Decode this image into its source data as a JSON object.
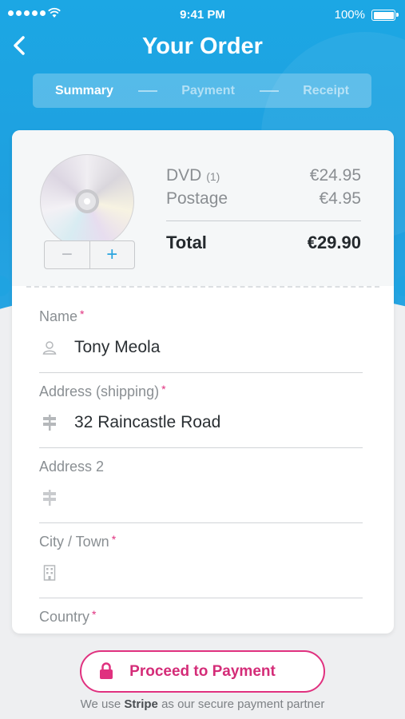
{
  "status_bar": {
    "time": "9:41 PM",
    "battery": "100%"
  },
  "header": {
    "title": "Your Order"
  },
  "steps": [
    {
      "label": "Summary",
      "active": true
    },
    {
      "label": "Payment",
      "active": false
    },
    {
      "label": "Receipt",
      "active": false
    }
  ],
  "order": {
    "item_name": "DVD",
    "item_qty": "(1)",
    "item_price": "€24.95",
    "postage_label": "Postage",
    "postage_price": "€4.95",
    "total_label": "Total",
    "total_price": "€29.90",
    "stepper": {
      "minus": "−",
      "plus": "+"
    }
  },
  "form": {
    "required_marker": "*",
    "name": {
      "label": "Name",
      "value": "Tony Meola",
      "icon": "person-icon"
    },
    "address": {
      "label": "Address (shipping)",
      "value": "32 Raincastle Road",
      "icon": "signpost-icon"
    },
    "address2": {
      "label": "Address 2",
      "value": "",
      "icon": "signpost-icon"
    },
    "city": {
      "label": "City / Town",
      "value": "",
      "icon": "building-icon"
    },
    "country": {
      "label": "Country"
    }
  },
  "cta": {
    "label": "Proceed to Payment",
    "note_prefix": "We use",
    "note_brand": "Stripe",
    "note_suffix": "as our secure payment partner"
  },
  "colors": {
    "primary_blue": "#1ca7e4",
    "accent_pink": "#e0317f"
  }
}
